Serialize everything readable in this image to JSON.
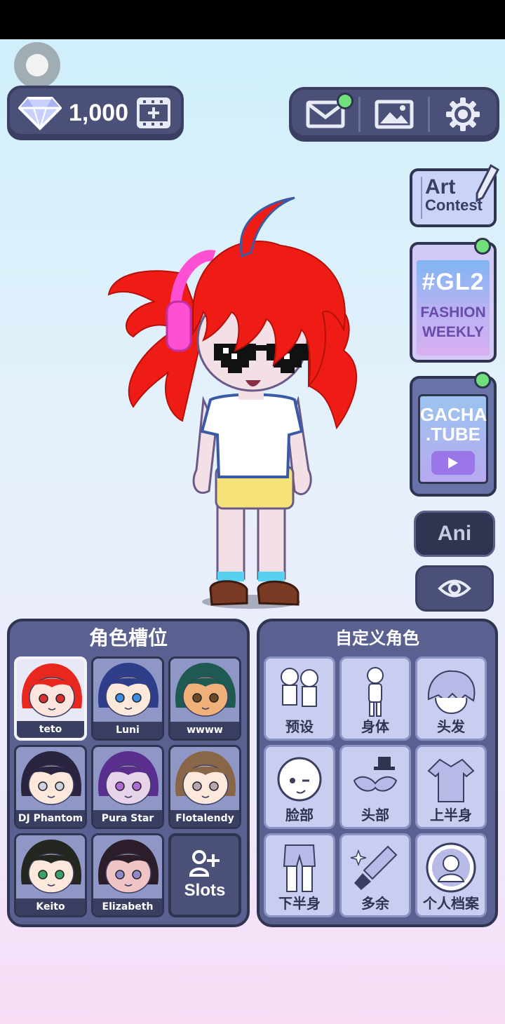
{
  "currency": {
    "gems": "1,000"
  },
  "side": {
    "art_contest": {
      "line1": "Art",
      "line2": "Contest"
    },
    "gl2": {
      "tag": "#GL2",
      "line1": "FASHION",
      "line2": "WEEKLY"
    },
    "gachatube": {
      "line1": "GACHA",
      "line2": ".TUBE"
    },
    "ani_label": "Ani"
  },
  "character_slots": {
    "title": "角色槽位",
    "slots": [
      {
        "name": "teto",
        "hair": "#e8281e",
        "eyes": "#d93030",
        "skin": "#fde4dc"
      },
      {
        "name": "Luni",
        "hair": "#2f3e8a",
        "eyes": "#3a8ce0",
        "skin": "#fde8dc"
      },
      {
        "name": "wwww",
        "hair": "#1f5a52",
        "eyes": "#6b4a2a",
        "skin": "#f0b07a"
      },
      {
        "name": "DJ Phantom",
        "hair": "#2a2440",
        "eyes": "#cfd0e0",
        "skin": "#fde8dc"
      },
      {
        "name": "Pura Star",
        "hair": "#5a2e8e",
        "eyes": "#b06ad8",
        "skin": "#e8d4ea"
      },
      {
        "name": "Flotalendy",
        "hair": "#8a6648",
        "eyes": "#b9a6b0",
        "skin": "#fde8dc"
      },
      {
        "name": "Keito",
        "hair": "#23271f",
        "eyes": "#3aa06a",
        "skin": "#fde8dc"
      },
      {
        "name": "Elizabeth",
        "hair": "#2b1e2a",
        "eyes": "#8e88c8",
        "skin": "#f0c4c4"
      }
    ],
    "add_label": "Slots"
  },
  "customize": {
    "title": "自定义角色",
    "items": [
      {
        "label": "预设",
        "icon": "presets-icon"
      },
      {
        "label": "身体",
        "icon": "body-icon"
      },
      {
        "label": "头发",
        "icon": "hair-icon"
      },
      {
        "label": "脸部",
        "icon": "face-icon"
      },
      {
        "label": "头部",
        "icon": "head-accessory-icon"
      },
      {
        "label": "上半身",
        "icon": "upper-body-icon"
      },
      {
        "label": "下半身",
        "icon": "lower-body-icon"
      },
      {
        "label": "多余",
        "icon": "extra-icon"
      },
      {
        "label": "个人档案",
        "icon": "profile-icon"
      }
    ]
  },
  "colors": {
    "panel": "#5a6190",
    "panel_dark": "#2f3450",
    "notify": "#6fe07a",
    "accent_hair": "#ee1c14"
  }
}
